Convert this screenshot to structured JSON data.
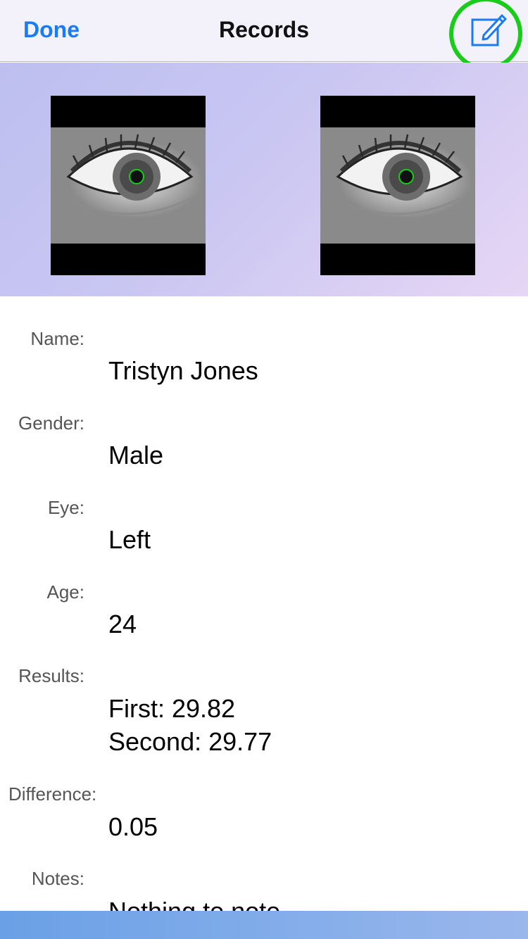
{
  "nav": {
    "done_label": "Done",
    "title": "Records",
    "edit_icon": "compose-icon",
    "accent": "#1a7cf5",
    "highlight_color": "#19cc1a"
  },
  "hero": {
    "images": [
      {
        "name": "left-eye-image",
        "icon": "eye-icon"
      },
      {
        "name": "right-eye-image",
        "icon": "eye-icon"
      }
    ]
  },
  "fields": {
    "name": {
      "label": "Name:",
      "value": "Tristyn Jones"
    },
    "gender": {
      "label": "Gender:",
      "value": "Male"
    },
    "eye": {
      "label": "Eye:",
      "value": "Left"
    },
    "age": {
      "label": "Age:",
      "value": "24"
    },
    "results": {
      "label": "Results:",
      "first": "First: 29.82",
      "second": "Second: 29.77"
    },
    "difference": {
      "label": "Difference:",
      "value": "0.05"
    },
    "notes": {
      "label": "Notes:",
      "value": "Nothing to note"
    }
  }
}
